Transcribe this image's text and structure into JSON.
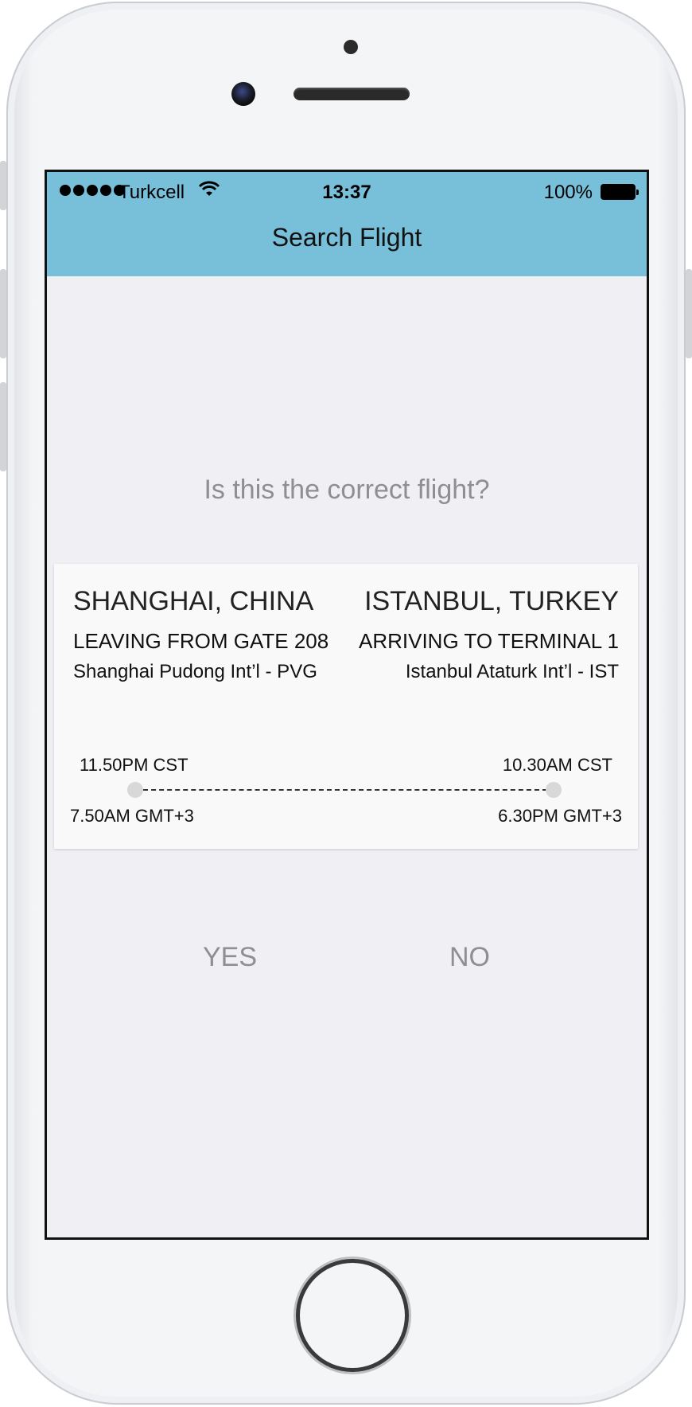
{
  "status_bar": {
    "carrier": "Turkcell",
    "time": "13:37",
    "battery": "100%"
  },
  "nav": {
    "title": "Search Flight"
  },
  "question": "Is this the correct flight?",
  "flight": {
    "origin": {
      "city": "SHANGHAI, CHINA",
      "gate": "LEAVING FROM GATE 208",
      "airport": "Shanghai Pudong Int’l - PVG",
      "local_time": "11.50PM CST",
      "gmt_time": "7.50AM GMT+3"
    },
    "destination": {
      "city": "ISTANBUL, TURKEY",
      "terminal": "ARRIVING TO TERMINAL 1",
      "airport": "Istanbul Ataturk Int’l - IST",
      "local_time": "10.30AM CST",
      "gmt_time": "6.30PM GMT+3"
    }
  },
  "actions": {
    "yes": "YES",
    "no": "NO"
  },
  "colors": {
    "nav_bar": "#78bfd9",
    "background": "#efeff4",
    "muted_text": "#8e8e93"
  }
}
